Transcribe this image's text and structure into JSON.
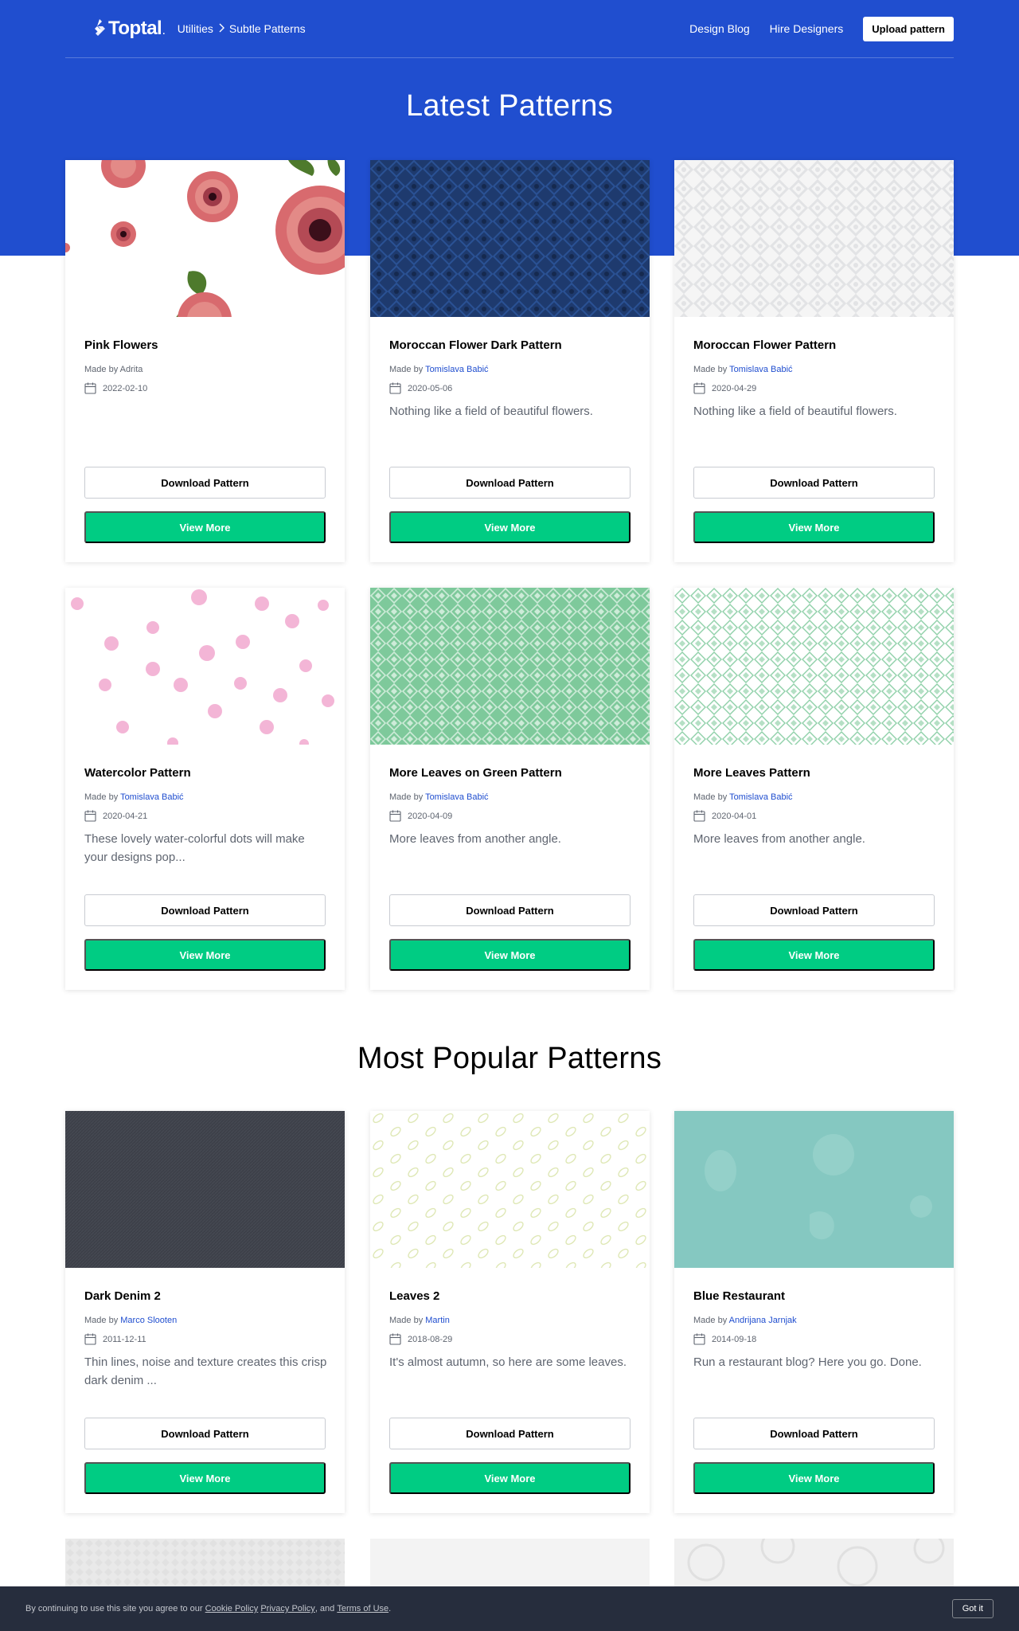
{
  "header": {
    "logo_text": "Toptal",
    "logo_dot": ".",
    "breadcrumb": [
      "Utilities",
      "Subtle Patterns"
    ],
    "nav_links": [
      "Design Blog",
      "Hire Designers"
    ],
    "upload_label": "Upload pattern"
  },
  "latest": {
    "title": "Latest Patterns",
    "cards": [
      {
        "title": "Pink Flowers",
        "made_by": "Made by",
        "author": "Adrita",
        "author_link": false,
        "date": "2022-02-10",
        "description": "",
        "download": "Download Pattern",
        "view": "View More"
      },
      {
        "title": "Moroccan Flower Dark Pattern",
        "made_by": "Made by",
        "author": "Tomislava Babić",
        "author_link": true,
        "date": "2020-05-06",
        "description": "Nothing like a field of beautiful flowers.",
        "download": "Download Pattern",
        "view": "View More"
      },
      {
        "title": "Moroccan Flower Pattern",
        "made_by": "Made by",
        "author": "Tomislava Babić",
        "author_link": true,
        "date": "2020-04-29",
        "description": "Nothing like a field of beautiful flowers.",
        "download": "Download Pattern",
        "view": "View More"
      },
      {
        "title": "Watercolor Pattern",
        "made_by": "Made by",
        "author": "Tomislava Babić",
        "author_link": true,
        "date": "2020-04-21",
        "description": "These lovely water-colorful dots will make your designs pop...",
        "download": "Download Pattern",
        "view": "View More"
      },
      {
        "title": "More Leaves on Green Pattern",
        "made_by": "Made by",
        "author": "Tomislava Babić",
        "author_link": true,
        "date": "2020-04-09",
        "description": "More leaves from another angle.",
        "download": "Download Pattern",
        "view": "View More"
      },
      {
        "title": "More Leaves Pattern",
        "made_by": "Made by",
        "author": "Tomislava Babić",
        "author_link": true,
        "date": "2020-04-01",
        "description": "More leaves from another angle.",
        "download": "Download Pattern",
        "view": "View More"
      }
    ]
  },
  "popular": {
    "title": "Most Popular Patterns",
    "cards": [
      {
        "title": "Dark Denim 2",
        "made_by": "Made by",
        "author": "Marco Slooten",
        "author_link": true,
        "date": "2011-12-11",
        "description": "Thin lines, noise and texture creates this crisp dark denim ...",
        "download": "Download Pattern",
        "view": "View More"
      },
      {
        "title": "Leaves 2",
        "made_by": "Made by",
        "author": "Martin",
        "author_link": true,
        "date": "2018-08-29",
        "description": "It's almost autumn, so here are some leaves.",
        "download": "Download Pattern",
        "view": "View More"
      },
      {
        "title": "Blue Restaurant",
        "made_by": "Made by",
        "author": "Andrijana Jarnjak",
        "author_link": true,
        "date": "2014-09-18",
        "description": "Run a restaurant blog? Here you go. Done.",
        "download": "Download Pattern",
        "view": "View More"
      }
    ]
  },
  "cookie": {
    "text_before": "By continuing to use this site you agree to our",
    "cookie_policy": "Cookie Policy",
    "privacy_policy": "Privacy Policy",
    "and_text": ", and",
    "terms": "Terms of Use",
    "period": ".",
    "got_it": "Got it"
  },
  "colors": {
    "hero_blue": "#204ecf",
    "green_button": "#00cc83",
    "link_blue": "#204ecf",
    "cookie_bar": "#262d3d"
  },
  "icons": [
    "toptal-logo-icon",
    "chevron-right-icon",
    "calendar-icon"
  ]
}
